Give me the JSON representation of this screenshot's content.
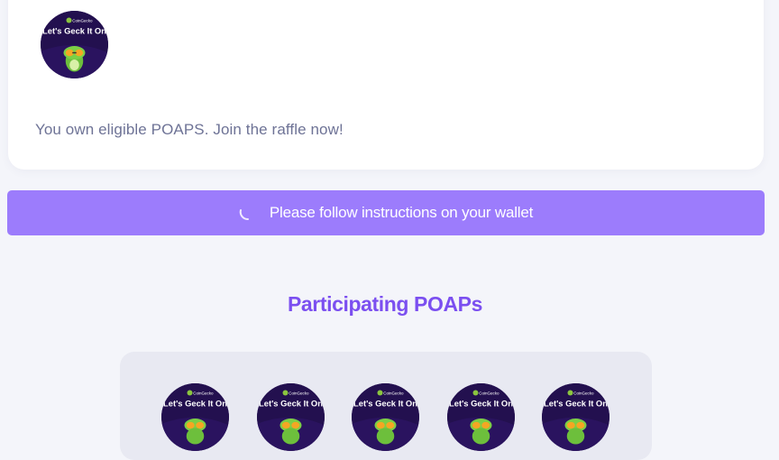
{
  "raffle_card": {
    "badge": {
      "icon": "poap-badge-icon",
      "title": "Let's Geck It On",
      "brand": "CoinGecko"
    },
    "eligible_message": "You own eligible POAPS. Join the raffle now!"
  },
  "wallet_button": {
    "label": "Please follow instructions on your wallet",
    "icon": "loading-spinner-icon",
    "color": "#9c7cfc"
  },
  "participating": {
    "title": "Participating POAPs",
    "title_color": "#7b4ff0",
    "poaps": [
      {
        "title": "Let's Geck It On",
        "brand": "CoinGecko"
      },
      {
        "title": "Let's Geck It On",
        "brand": "CoinGecko"
      },
      {
        "title": "Let's Geck It On",
        "brand": "CoinGecko"
      },
      {
        "title": "Let's Geck It On",
        "brand": "CoinGecko"
      },
      {
        "title": "Let's Geck It On",
        "brand": "CoinGecko"
      }
    ]
  }
}
